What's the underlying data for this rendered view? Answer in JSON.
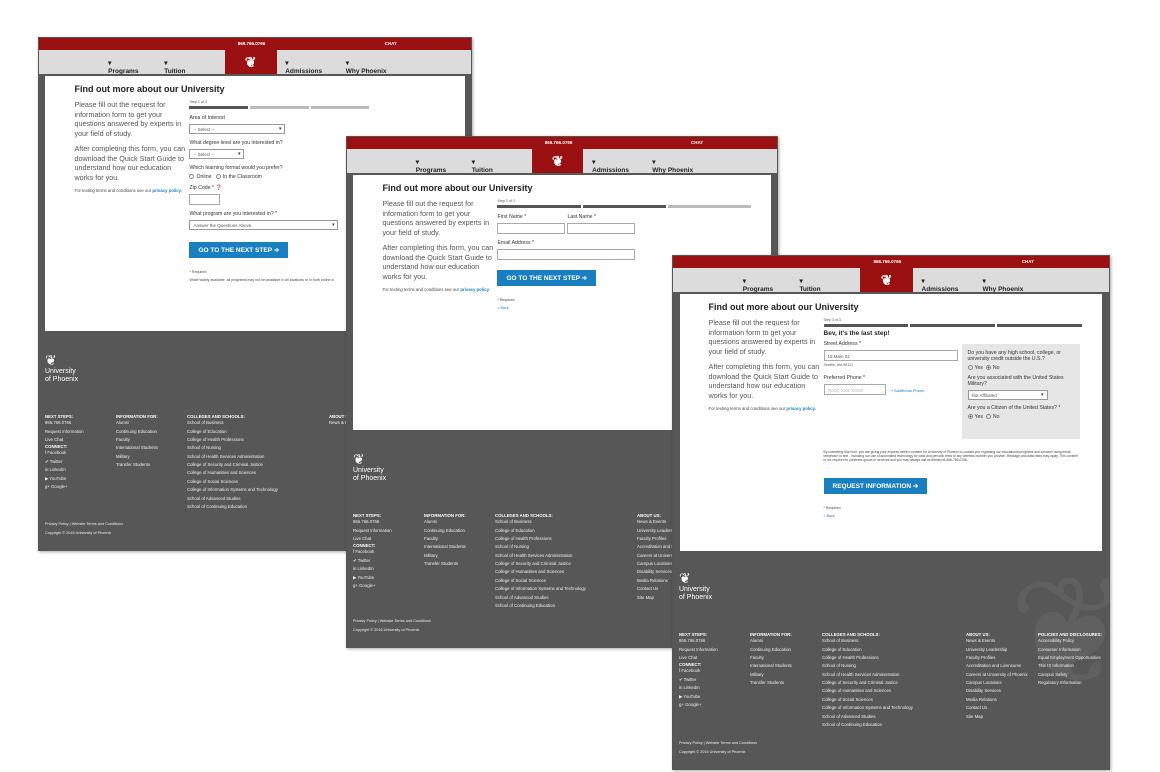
{
  "phone": "866.766.0766",
  "chat": "CHAT",
  "nav": {
    "programs": "Programs",
    "tuition": "Tuition",
    "admissions": "Admissions",
    "why": "Why Phoenix"
  },
  "card": {
    "title": "Find out more about our University",
    "intro1": "Please fill out the request for information form to get your questions answered by experts in your field of study.",
    "intro2": "After completing this form, you can download the Quick Start Guide to understand how our education works for you.",
    "terms": "For texting terms and conditions see our",
    "privacy": "privacy policy."
  },
  "step1": {
    "step": "Step 1 of 3",
    "area_label": "Area of Interest",
    "area_value": "-- Select --",
    "degree_label": "What degree level are you interested in?",
    "degree_value": "-- Select --",
    "format_label": "Which learning format would you prefer?",
    "format_online": "Online",
    "format_classroom": "In the Classroom",
    "zip_label": "Zip Code *",
    "program_label": "What program are you interested in? *",
    "program_value": "Answer the Questions Above",
    "button": "GO TO THE NEXT STEP ➔",
    "required": "* Required",
    "disclaimer": "While widely available, all programs may not be available in all locations or in both online a"
  },
  "step2": {
    "step": "Step 2 of 3",
    "first": "First Name *",
    "last": "Last Name *",
    "email": "Email Address *",
    "button": "GO TO THE NEXT STEP ➔",
    "required": "* Required",
    "back": "< Back"
  },
  "step3": {
    "step": "Step 3 of 3",
    "heading": "Bev, it's the last step!",
    "street_label": "Street Address *",
    "street_value": "15 Main St.",
    "city": "Seattle, WA 98121",
    "phone_label": "Preferred Phone *",
    "phone_placeholder": "(XXX) XXX-XXXX",
    "add_phone": "+ Additional Phone",
    "q1": "Do you have any high school, college, or university credit outside the U.S.?",
    "yes": "Yes",
    "no": "No",
    "q2": "Are you associated with the United States Military?",
    "q2_value": "Not Affiliated",
    "q3": "Are you a Citizen of the United States? *",
    "consent": "By submitting this form, you are giving your express written consent for University of Phoenix to contact you regarding our educational programs and services using email, telephone or text - including our use of automated technology for calls and periodic texts to any wireless number you provide. Message and data rates may apply. This consent is not required to purchase goods or services and you may always call us directly at 866-766-0766.",
    "button": "REQUEST INFORMATION ➔",
    "required": "* Required",
    "back": "< Back"
  },
  "footer": {
    "brand1": "University",
    "brand2": "of Phoenix",
    "next_h": "NEXT STEPS:",
    "next": [
      "866.766.0766",
      "Request Information",
      "Live Chat"
    ],
    "connect_h": "CONNECT:",
    "connect": [
      "f Facebook",
      "✔ Twitter",
      "in LinkedIn",
      "▶ YouTube",
      "g+ Google+"
    ],
    "info_h": "INFORMATION FOR:",
    "info": [
      "Alumni",
      "Continuing Education",
      "Faculty",
      "International Students",
      "Military",
      "Transfer Students"
    ],
    "col_h": "COLLEGES AND SCHOOLS:",
    "col": [
      "School of Business",
      "College of Education",
      "College of Health Professions",
      "School of Nursing",
      "School of Health Services Administration",
      "College of Security and Criminal Justice",
      "College of Humanities and Sciences",
      "College of Social Sciences",
      "College of Information Systems and Technology",
      "School of Advanced Studies",
      "School of Continuing Education"
    ],
    "about_h": "ABOUT US:",
    "about": [
      "News & Events",
      "University Leadership",
      "Faculty Profiles",
      "Accreditation and Licensures",
      "Careers at University of Phoenix",
      "Campus Locations",
      "Disability Services",
      "Media Relations",
      "Contact Us",
      "Site Map"
    ],
    "pol_h": "POLICIES AND DISCLOSURES:",
    "pol": [
      "Accessibility Policy",
      "Consumer Information",
      "Equal Employment Opportunities",
      "Title IX Information",
      "Campus Safety",
      "Regulatory Information"
    ],
    "links": "Privacy Policy | Website Terms and Conditions",
    "copyright": "Copyright © 2016 University of Phoenix"
  }
}
